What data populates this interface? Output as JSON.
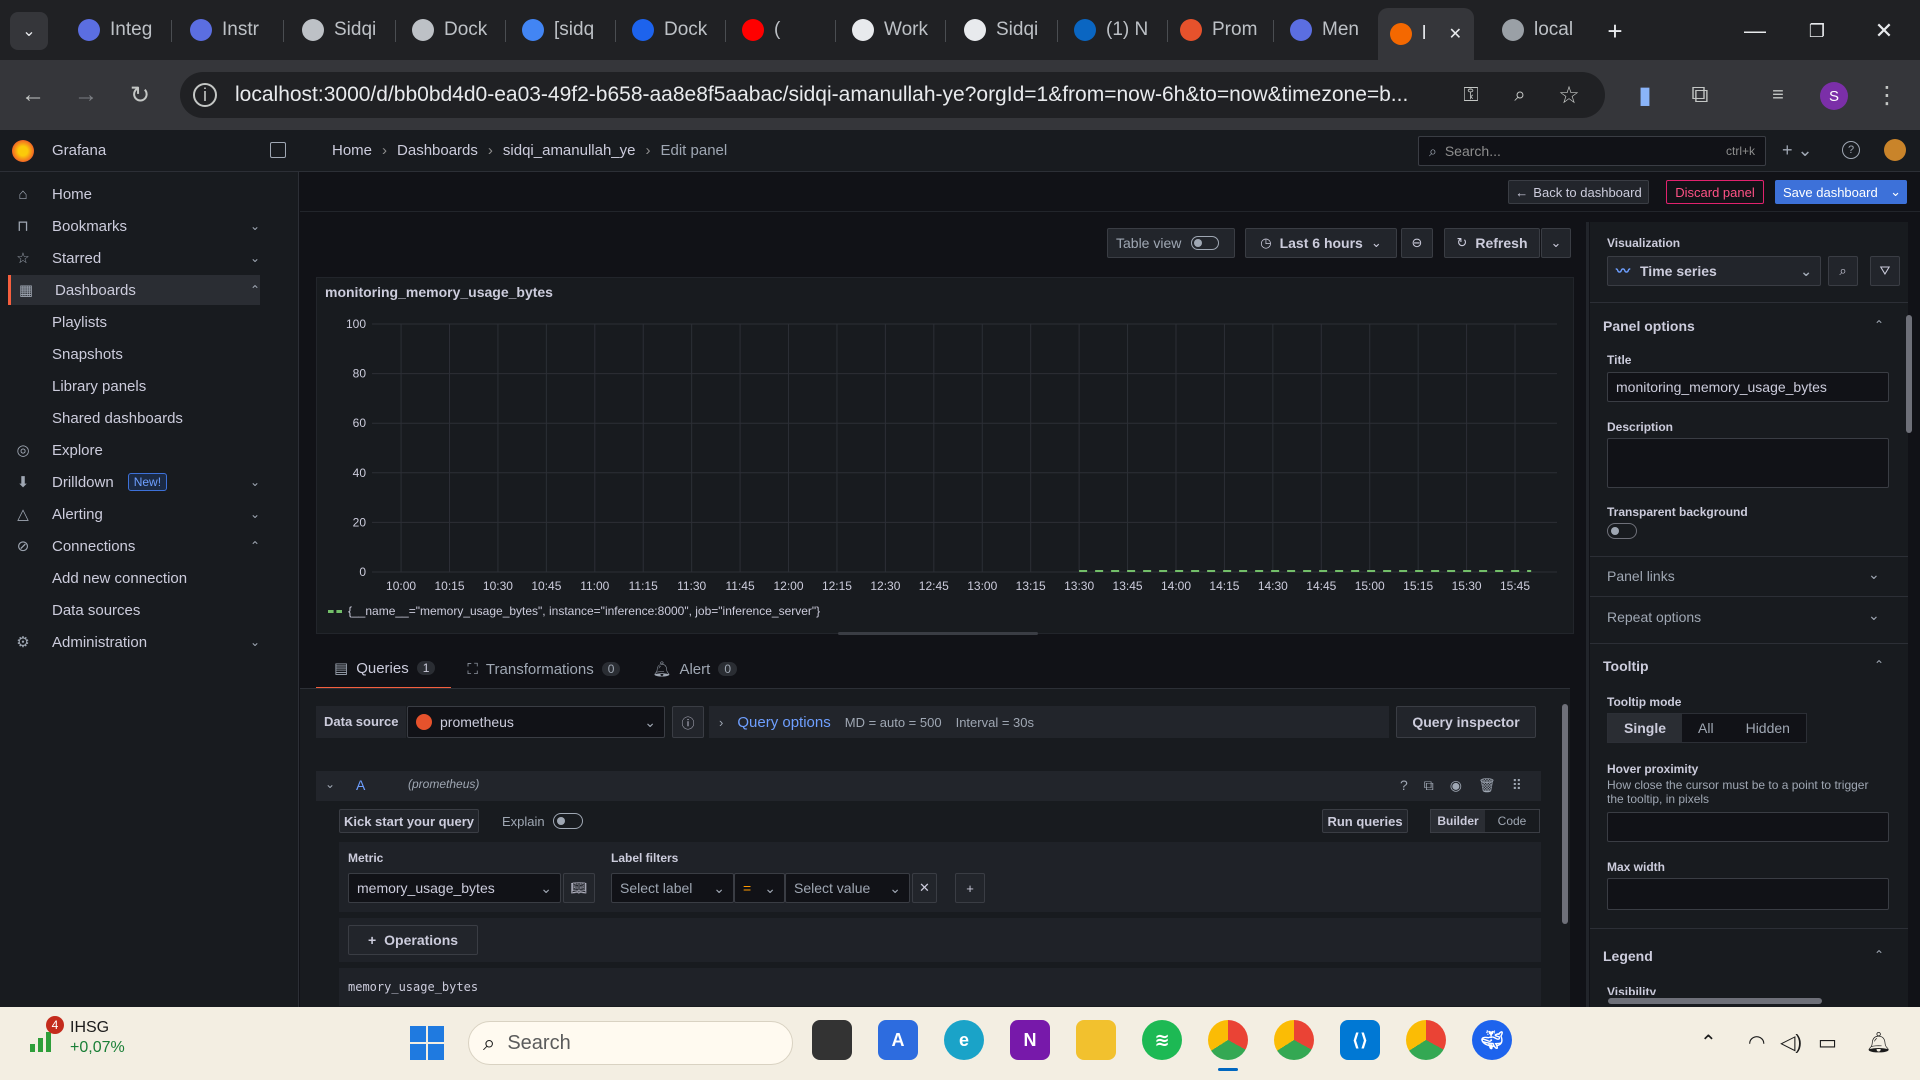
{
  "browser": {
    "tabs": [
      {
        "label": "Integ",
        "icon": "grafana-icon",
        "color": "#5b6ee1"
      },
      {
        "label": "Instr",
        "icon": "grafana-icon",
        "color": "#5b6ee1"
      },
      {
        "label": "Sidqi",
        "icon": "cat-icon",
        "color": "#bdc1c6"
      },
      {
        "label": "Dock",
        "icon": "openai-icon",
        "color": "#bdc1c6"
      },
      {
        "label": "[sidq",
        "icon": "google-icon",
        "color": "#4285f4"
      },
      {
        "label": "Dock",
        "icon": "docker-icon",
        "color": "#1d63ed"
      },
      {
        "label": "(",
        "icon": "youtube-icon",
        "color": "#ff0000"
      },
      {
        "label": "Work",
        "icon": "github-icon",
        "color": "#e8eaed"
      },
      {
        "label": "Sidqi",
        "icon": "github-icon",
        "color": "#e8eaed"
      },
      {
        "label": "(1) N",
        "icon": "linkedin-icon",
        "color": "#0a66c2"
      },
      {
        "label": "Prom",
        "icon": "prometheus-icon",
        "color": "#e6522c"
      },
      {
        "label": "Men",
        "icon": "grafana-icon",
        "color": "#5b6ee1"
      },
      {
        "label": "l",
        "icon": "grafana-icon",
        "color": "#f46800"
      },
      {
        "label": "local",
        "icon": "globe-icon",
        "color": "#9aa0a6"
      }
    ],
    "url": "localhost:3000/d/bb0bd4d0-ea03-49f2-b658-aa8e8f5aabac/sidqi-amanullah-ye?orgId=1&from=now-6h&to=now&timezone=b...",
    "profile_initial": "S"
  },
  "grafana": {
    "brand": "Grafana",
    "breadcrumb": [
      "Home",
      "Dashboards",
      "sidqi_amanullah_ye",
      "Edit panel"
    ],
    "search_placeholder": "Search...",
    "search_shortcut": "ctrl+k",
    "actions": {
      "back": "Back to dashboard",
      "discard": "Discard panel",
      "save": "Save dashboard"
    }
  },
  "sidebar": {
    "items": [
      {
        "label": "Home",
        "icon": "home-icon",
        "chev": ""
      },
      {
        "label": "Bookmarks",
        "icon": "bookmark-icon",
        "chev": "⌄"
      },
      {
        "label": "Starred",
        "icon": "star-icon",
        "chev": "⌄"
      },
      {
        "label": "Dashboards",
        "icon": "dashboards-icon",
        "chev": "⌃"
      },
      {
        "label": "Playlists",
        "sub": true
      },
      {
        "label": "Snapshots",
        "sub": true
      },
      {
        "label": "Library panels",
        "sub": true
      },
      {
        "label": "Shared dashboards",
        "sub": true
      },
      {
        "label": "Explore",
        "icon": "explore-icon",
        "chev": ""
      },
      {
        "label": "Drilldown",
        "icon": "drilldown-icon",
        "chev": "⌄",
        "badge": "New!"
      },
      {
        "label": "Alerting",
        "icon": "bell-icon",
        "chev": "⌄"
      },
      {
        "label": "Connections",
        "icon": "connections-icon",
        "chev": "⌃"
      },
      {
        "label": "Add new connection",
        "sub": true
      },
      {
        "label": "Data sources",
        "sub": true
      },
      {
        "label": "Administration",
        "icon": "gear-icon",
        "chev": "⌄"
      }
    ]
  },
  "panel_toolbar": {
    "table_view": "Table view",
    "time_range": "Last 6 hours",
    "refresh": "Refresh"
  },
  "panel": {
    "title": "monitoring_memory_usage_bytes",
    "legend": "{__name__=\"memory_usage_bytes\", instance=\"inference:8000\", job=\"inference_server\"}"
  },
  "chart_data": {
    "type": "line",
    "title": "monitoring_memory_usage_bytes",
    "x_ticks": [
      "10:00",
      "10:15",
      "10:30",
      "10:45",
      "11:00",
      "11:15",
      "11:30",
      "11:45",
      "12:00",
      "12:15",
      "12:30",
      "12:45",
      "13:00",
      "13:15",
      "13:30",
      "13:45",
      "14:00",
      "14:15",
      "14:30",
      "14:45",
      "15:00",
      "15:15",
      "15:30",
      "15:45"
    ],
    "y_ticks": [
      0,
      20,
      40,
      60,
      80,
      100
    ],
    "ylim": [
      0,
      100
    ],
    "grid": true,
    "legend_position": "bottom",
    "series": [
      {
        "name": "{__name__=\"memory_usage_bytes\", instance=\"inference:8000\", job=\"inference_server\"}",
        "color": "#73bf69",
        "style": "dashed",
        "x_start": "13:30",
        "x_end": "15:50",
        "value": 0
      }
    ]
  },
  "query_tabs": [
    {
      "label": "Queries",
      "count": "1"
    },
    {
      "label": "Transformations",
      "count": "0"
    },
    {
      "label": "Alert",
      "count": "0"
    }
  ],
  "query": {
    "datasource_label": "Data source",
    "datasource": "prometheus",
    "query_options": "Query options",
    "md": "MD = auto = 500",
    "interval": "Interval = 30s",
    "inspector": "Query inspector",
    "ref_id": "A",
    "ref_ds": "(prometheus)",
    "kickstart": "Kick start your query",
    "explain": "Explain",
    "run": "Run queries",
    "builder": "Builder",
    "code": "Code",
    "metric_label": "Metric",
    "metric_value": "memory_usage_bytes",
    "label_filters": "Label filters",
    "select_label": "Select label",
    "operator": "=",
    "select_value": "Select value",
    "operations": "Operations",
    "preview": "memory_usage_bytes"
  },
  "options": {
    "visualization_label": "Visualization",
    "visualization": "Time series",
    "panel_options": "Panel options",
    "title_label": "Title",
    "title_value": "monitoring_memory_usage_bytes",
    "description_label": "Description",
    "transparent_label": "Transparent background",
    "panel_links": "Panel links",
    "repeat_options": "Repeat options",
    "tooltip": "Tooltip",
    "tooltip_mode": "Tooltip mode",
    "tooltip_modes": [
      "Single",
      "All",
      "Hidden"
    ],
    "hover_label": "Hover proximity",
    "hover_desc": "How close the cursor must be to a point to trigger the tooltip, in pixels",
    "max_width": "Max width",
    "legend": "Legend",
    "visibility": "Visibility"
  },
  "taskbar": {
    "stock_name": "IHSG",
    "stock_change": "+0,07%",
    "stock_badge": "4",
    "search": "Search"
  }
}
